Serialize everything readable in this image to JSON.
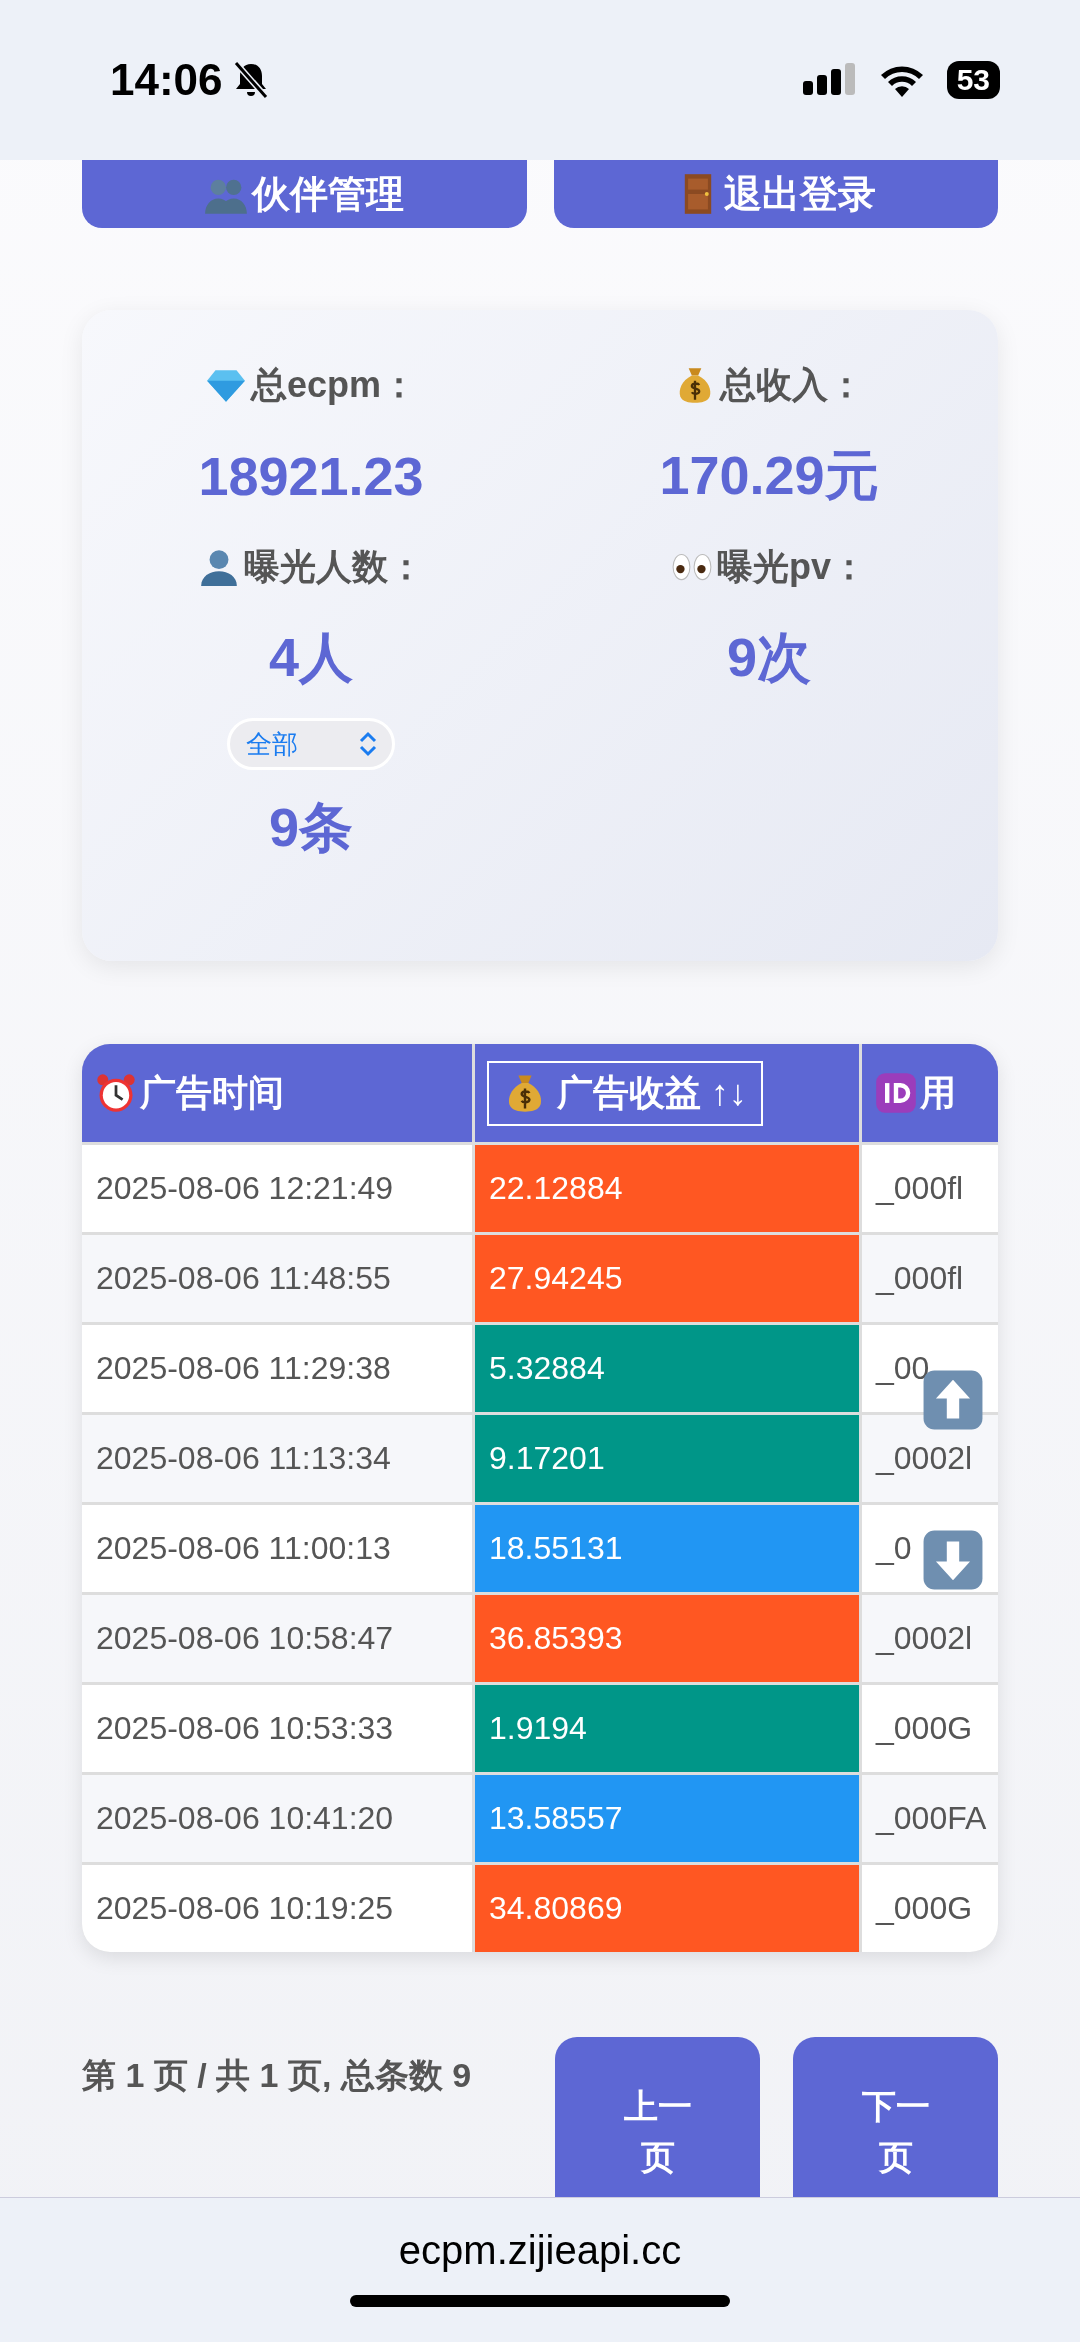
{
  "status_bar": {
    "time": "14:06",
    "battery": "53"
  },
  "nav_buttons": [
    {
      "label": "伙伴管理",
      "kind": "partners"
    },
    {
      "label": "退出登录",
      "kind": "logout"
    }
  ],
  "stats": [
    {
      "label": "总ecpm：",
      "value": "18921.23",
      "kind": "diamond"
    },
    {
      "label": "总收入：",
      "value": "170.29元",
      "kind": "money"
    },
    {
      "label": "曝光人数：",
      "value": "4人",
      "kind": "person"
    },
    {
      "label": "曝光pv：",
      "value": "9次",
      "kind": "eyes"
    }
  ],
  "filter": {
    "value": "全部",
    "count": "9条"
  },
  "table": {
    "columns": [
      {
        "label": "广告时间",
        "kind": "clock",
        "sortable": false
      },
      {
        "label": "广告收益 ↑↓",
        "kind": "money",
        "sortable": true
      },
      {
        "label": "用",
        "kind": "id",
        "sortable": false
      }
    ],
    "rows": [
      {
        "time": "2025-08-06 12:21:49",
        "revenue": "22.12884",
        "color": "#ff5722",
        "user": "_000fl"
      },
      {
        "time": "2025-08-06 11:48:55",
        "revenue": "27.94245",
        "color": "#ff5722",
        "user": "_000fl"
      },
      {
        "time": "2025-08-06 11:29:38",
        "revenue": "5.32884",
        "color": "#009688",
        "user": "_00"
      },
      {
        "time": "2025-08-06 11:13:34",
        "revenue": "9.17201",
        "color": "#009688",
        "user": "_0002l"
      },
      {
        "time": "2025-08-06 11:00:13",
        "revenue": "18.55131",
        "color": "#2196f3",
        "user": "_0"
      },
      {
        "time": "2025-08-06 10:58:47",
        "revenue": "36.85393",
        "color": "#ff5722",
        "user": "_0002l"
      },
      {
        "time": "2025-08-06 10:53:33",
        "revenue": "1.9194",
        "color": "#009688",
        "user": "_000G"
      },
      {
        "time": "2025-08-06 10:41:20",
        "revenue": "13.58557",
        "color": "#2196f3",
        "user": "_000FA"
      },
      {
        "time": "2025-08-06 10:19:25",
        "revenue": "34.80869",
        "color": "#ff5722",
        "user": "_000G"
      }
    ]
  },
  "pagination": {
    "info": "第 1 页 / 共 1 页, 总条数 9",
    "prev": "上一页",
    "next": "下一页"
  },
  "address_bar": {
    "url": "ecpm.zijieapi.cc"
  }
}
